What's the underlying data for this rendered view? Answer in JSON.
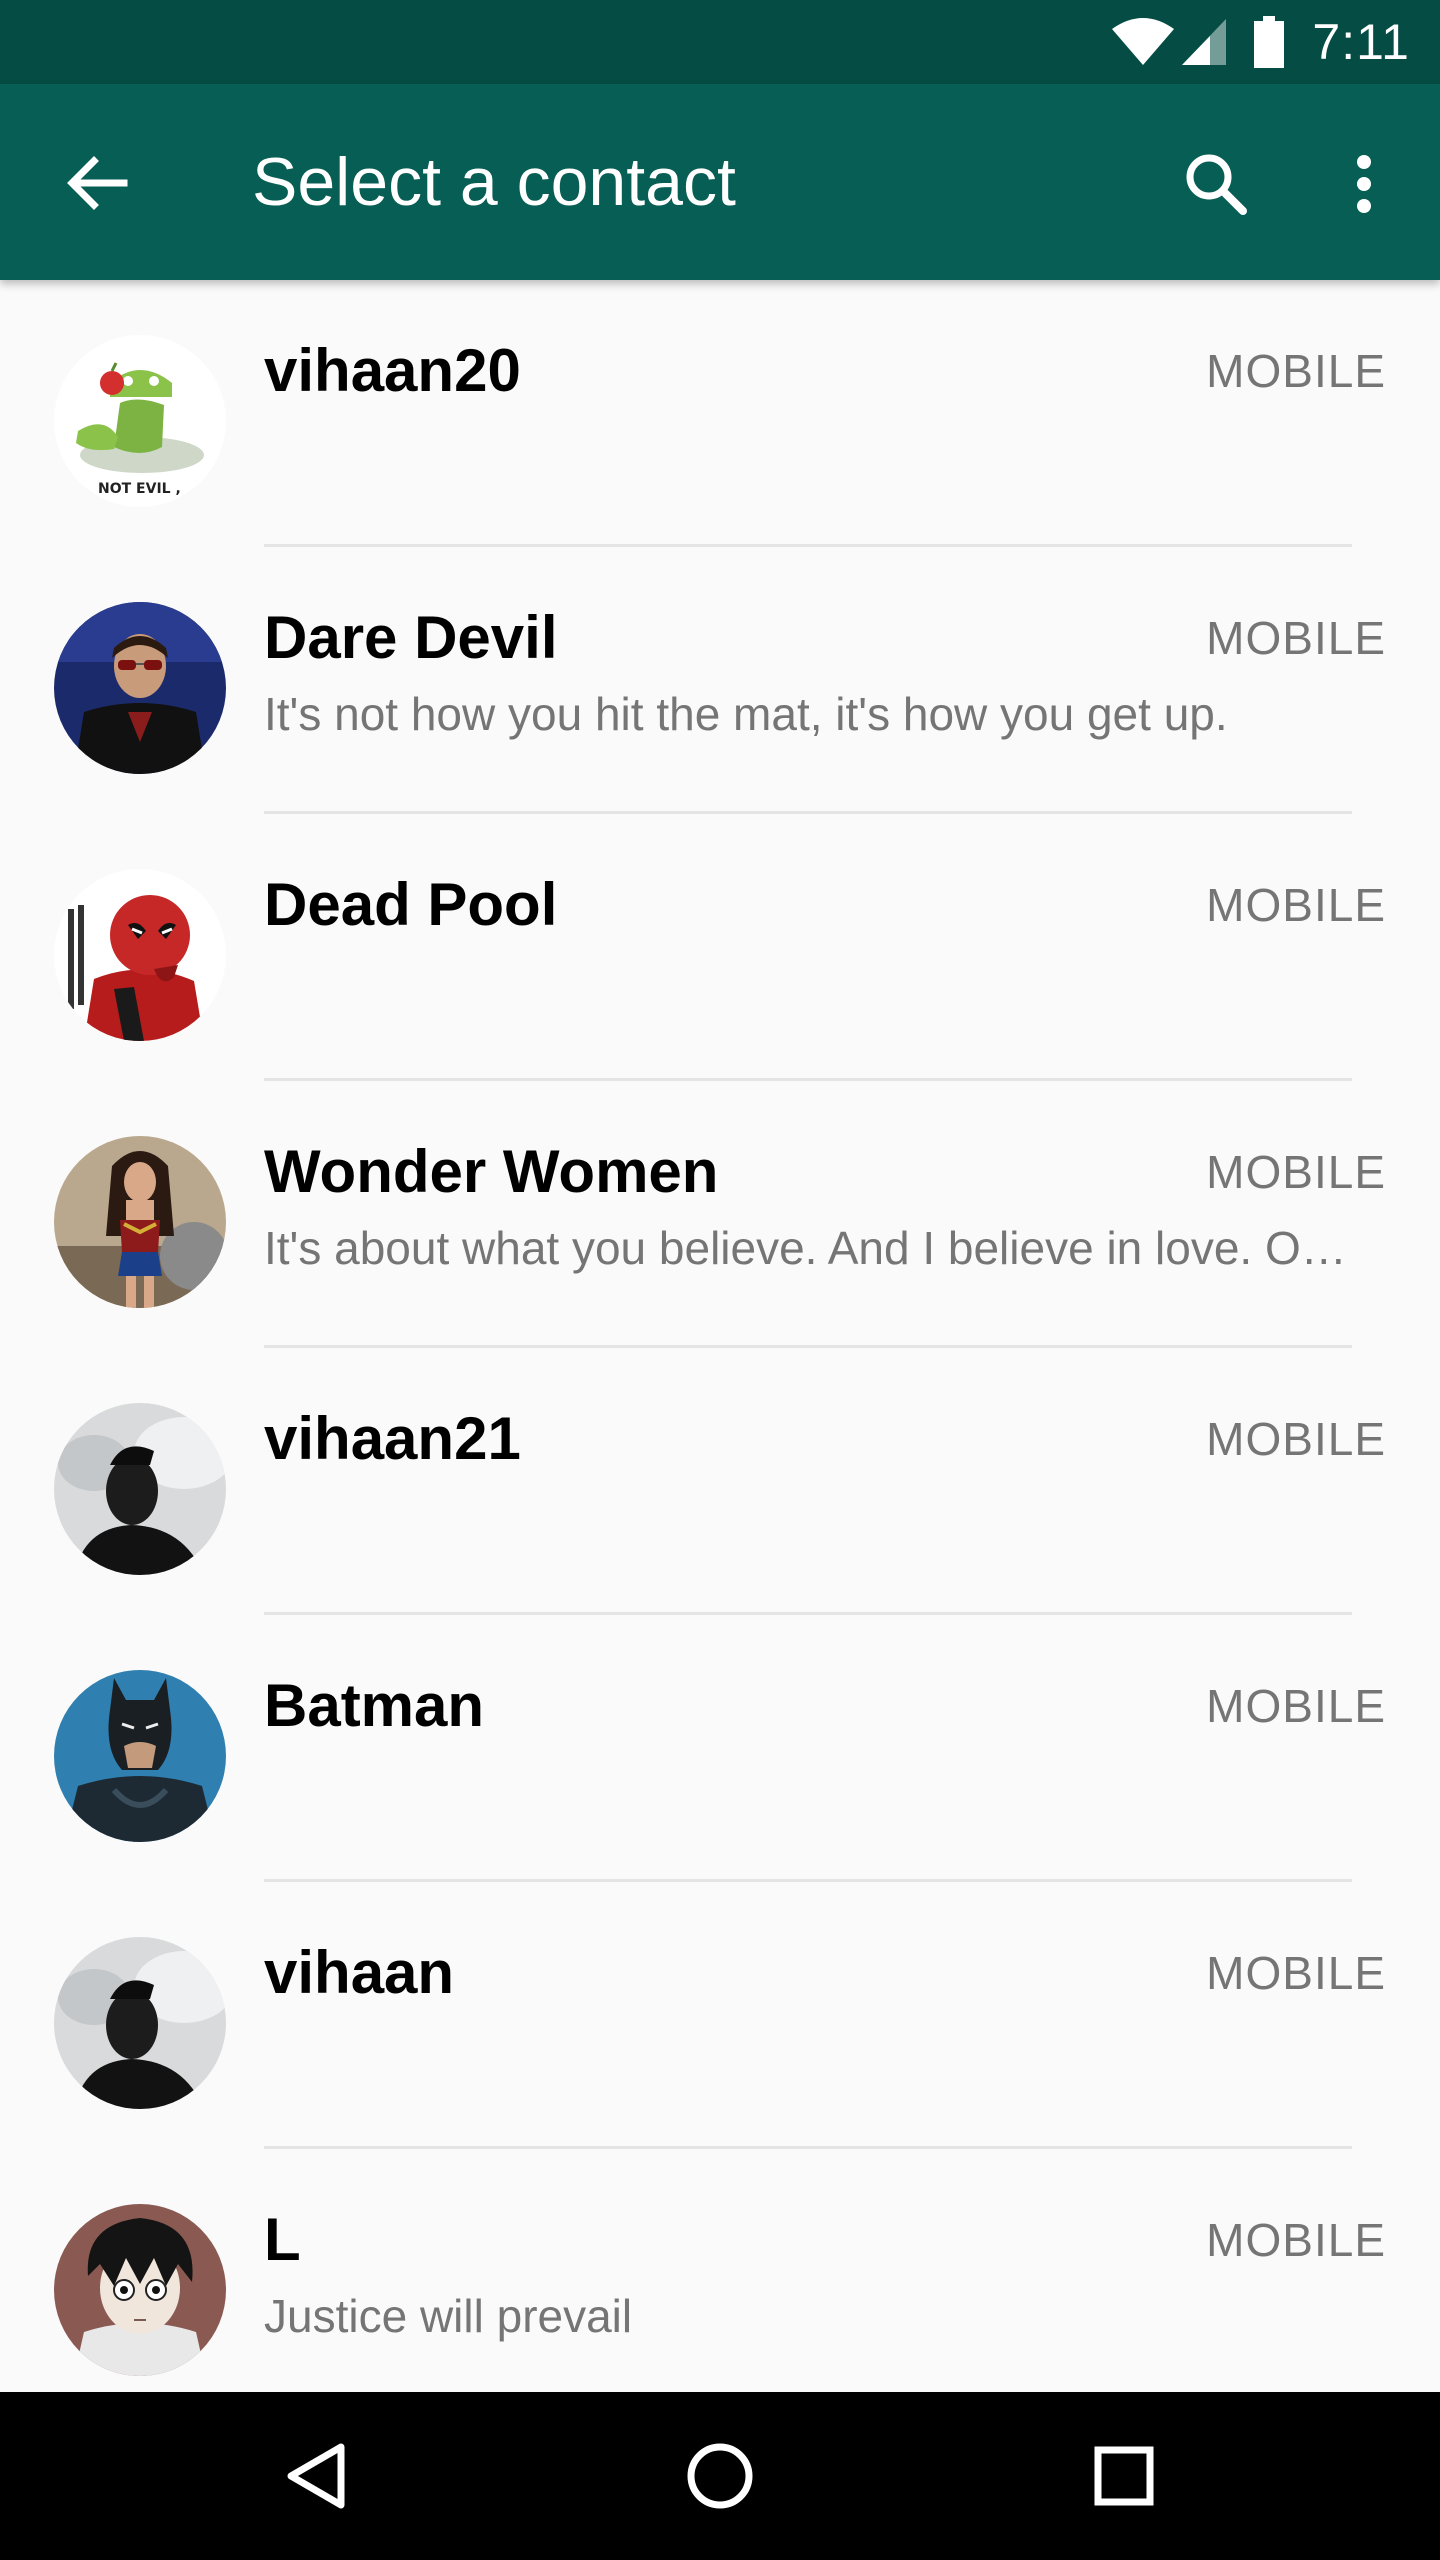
{
  "status_bar": {
    "time": "7:11",
    "icons": [
      "wifi-icon",
      "cell-signal-icon",
      "battery-icon"
    ]
  },
  "app_bar": {
    "title": "Select a contact",
    "back_icon": "arrow-back-icon",
    "search_icon": "search-icon",
    "more_icon": "more-vert-icon"
  },
  "contacts": [
    {
      "name": "vihaan20",
      "status": "",
      "type": "MOBILE",
      "avatar": "android-not-evil-avatar"
    },
    {
      "name": "Dare Devil",
      "status": "It's not how you hit the mat, it's how you get up.",
      "type": "MOBILE",
      "avatar": "daredevil-avatar"
    },
    {
      "name": "Dead Pool",
      "status": "",
      "type": "MOBILE",
      "avatar": "deadpool-avatar"
    },
    {
      "name": "Wonder Women",
      "status": "It's about what you believe. And I believe in love. O…",
      "type": "MOBILE",
      "avatar": "wonder-woman-avatar"
    },
    {
      "name": "vihaan21",
      "status": "",
      "type": "MOBILE",
      "avatar": "person-silhouette-avatar"
    },
    {
      "name": "Batman",
      "status": "",
      "type": "MOBILE",
      "avatar": "batman-avatar"
    },
    {
      "name": "vihaan",
      "status": "",
      "type": "MOBILE",
      "avatar": "person-silhouette-avatar"
    },
    {
      "name": "L",
      "status": "Justice will prevail",
      "type": "MOBILE",
      "avatar": "anime-l-avatar"
    }
  ],
  "avatar_text": {
    "android": "NOT EVIL ,"
  },
  "nav_bar": {
    "icons": [
      "back-triangle-icon",
      "home-circle-icon",
      "recents-square-icon"
    ]
  },
  "colors": {
    "status_bar": "#054d44",
    "app_bar": "#075e54",
    "background": "#fafafa",
    "secondary_text": "#757575"
  }
}
